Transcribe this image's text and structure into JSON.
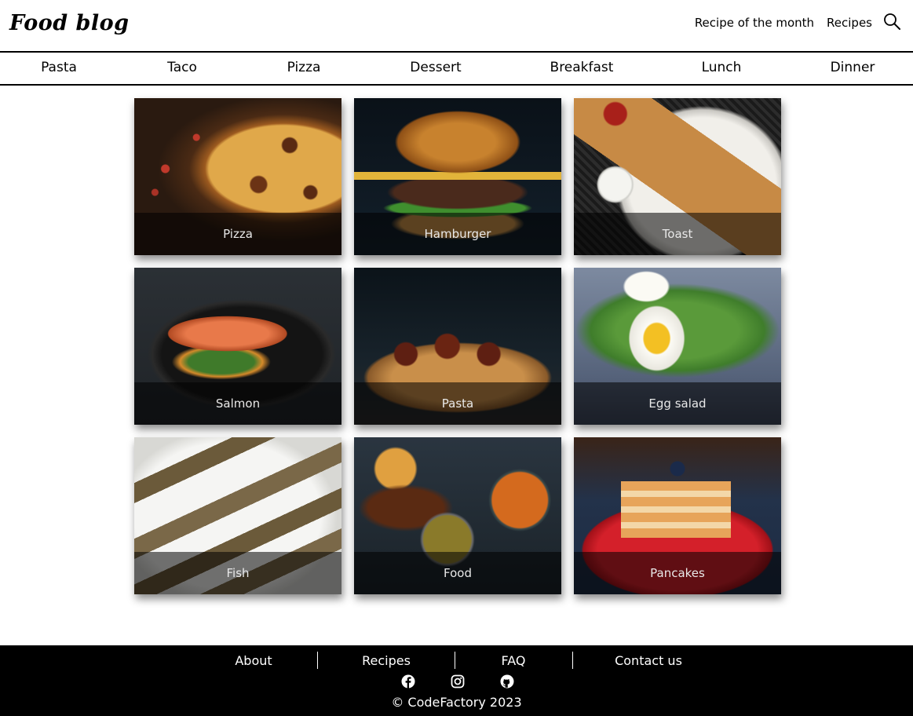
{
  "header": {
    "logo": "Food blog",
    "links": [
      "Recipe of the month",
      "Recipes"
    ],
    "search_icon": "search-icon"
  },
  "categories": [
    "Pasta",
    "Taco",
    "Pizza",
    "Dessert",
    "Breakfast",
    "Lunch",
    "Dinner"
  ],
  "cards": [
    {
      "label": "Pizza"
    },
    {
      "label": "Hamburger"
    },
    {
      "label": "Toast"
    },
    {
      "label": "Salmon"
    },
    {
      "label": "Pasta"
    },
    {
      "label": "Egg salad"
    },
    {
      "label": "Fish"
    },
    {
      "label": "Food"
    },
    {
      "label": "Pancakes"
    }
  ],
  "footer": {
    "links": [
      "About",
      "Recipes",
      "FAQ",
      "Contact us"
    ],
    "social_icons": [
      "facebook-icon",
      "instagram-icon",
      "github-icon"
    ],
    "copyright": "© CodeFactory 2023"
  }
}
